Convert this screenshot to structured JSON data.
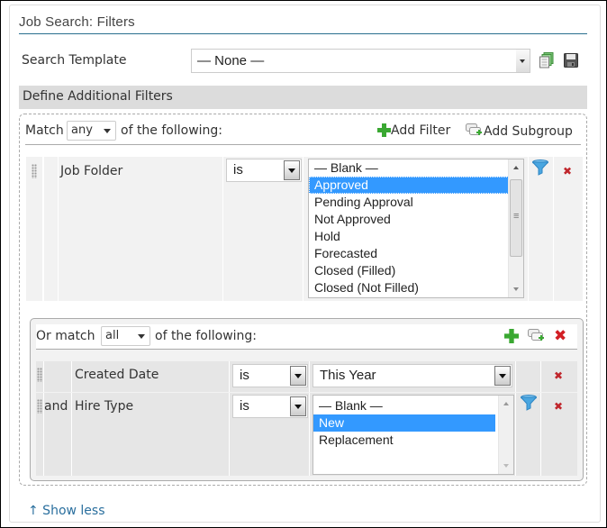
{
  "panel": {
    "title": "Job Search: Filters"
  },
  "search_template": {
    "label": "Search Template",
    "value": "— None —",
    "copy_icon": "copy-icon",
    "save_icon": "save-icon"
  },
  "section": {
    "title": "Define Additional Filters"
  },
  "main_group": {
    "prefix": "Match",
    "match_mode": "any",
    "suffix": "of the following:",
    "add_filter_label": "Add Filter",
    "add_subgroup_label": "Add Subgroup",
    "filters": [
      {
        "conjunction": "",
        "field": "Job Folder",
        "operator": "is",
        "options": [
          "— Blank —",
          "Approved",
          "Pending Approval",
          "Not Approved",
          "Hold",
          "Forecasted",
          "Closed (Filled)",
          "Closed (Not Filled)"
        ],
        "selected": [
          "Approved"
        ]
      }
    ]
  },
  "subgroup": {
    "prefix": "Or match",
    "match_mode": "all",
    "suffix": "of the following:",
    "filters": [
      {
        "conjunction": "",
        "field": "Created Date",
        "operator": "is",
        "value": "This Year"
      },
      {
        "conjunction": "and",
        "field": "Hire Type",
        "operator": "is",
        "options": [
          "— Blank —",
          "New",
          "Replacement"
        ],
        "selected": [
          "New"
        ]
      }
    ]
  },
  "footer": {
    "show_less_label": "↑ Show less"
  },
  "colors": {
    "title_rule": "#2a6f8e",
    "selected_option": "#3399ff",
    "link": "#2a6f9e",
    "remove": "#c0262c",
    "add": "#3aa832"
  }
}
